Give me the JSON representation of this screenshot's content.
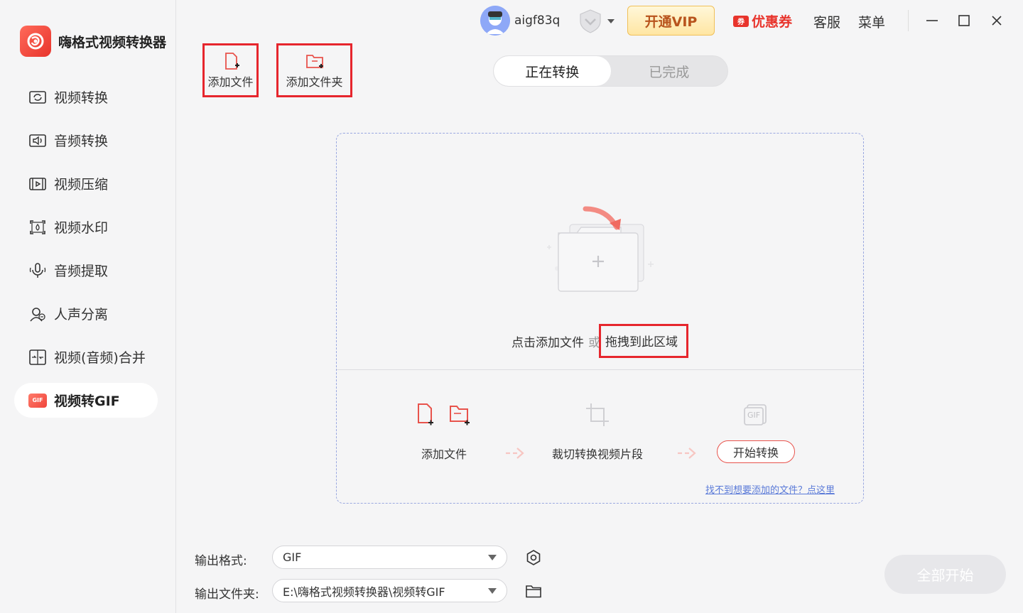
{
  "app": {
    "title": "嗨格式视频转换器"
  },
  "sidebar": {
    "items": [
      {
        "label": "视频转换",
        "icon": "video-convert-icon"
      },
      {
        "label": "音频转换",
        "icon": "audio-convert-icon"
      },
      {
        "label": "视频压缩",
        "icon": "video-compress-icon"
      },
      {
        "label": "视频水印",
        "icon": "video-watermark-icon"
      },
      {
        "label": "音频提取",
        "icon": "audio-extract-icon"
      },
      {
        "label": "人声分离",
        "icon": "voice-separate-icon"
      },
      {
        "label": "视频(音频)合并",
        "icon": "merge-icon"
      },
      {
        "label": "视频转GIF",
        "icon": "gif-icon",
        "active": true
      }
    ]
  },
  "topbar": {
    "username": "aigf83q",
    "vip_label": "开通VIP",
    "coupon_label": "优惠券",
    "coupon_tag": "券",
    "service_label": "客服",
    "menu_label": "菜单"
  },
  "toolbar": {
    "add_file": "添加文件",
    "add_folder": "添加文件夹"
  },
  "tabs": [
    {
      "label": "正在转换",
      "active": true
    },
    {
      "label": "已完成",
      "active": false
    }
  ],
  "dropzone": {
    "hint_click": "点击添加文件",
    "hint_or": "或",
    "hint_drag": "拖拽到此区域",
    "step1": "添加文件",
    "step2": "裁切转换视频片段",
    "step3": "开始转换",
    "gif_label": "GIF",
    "help_link": "找不到想要添加的文件？点这里"
  },
  "output": {
    "format_label": "输出格式:",
    "format_value": "GIF",
    "folder_label": "输出文件夹:",
    "folder_value": "E:\\嗨格式视频转换器\\视频转GIF"
  },
  "start_all": "全部开始",
  "colors": {
    "accent": "#e8342c",
    "highlight_box": "#e6262d"
  }
}
